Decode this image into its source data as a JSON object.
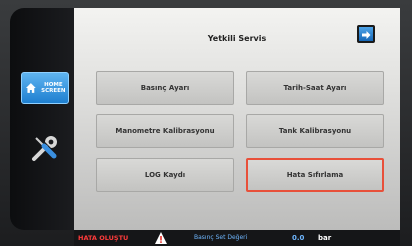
{
  "sidebar": {
    "home_label": "HOME\nSCREEN",
    "home_icon": "house-icon",
    "service_icon": "wrench-screwdriver-icon"
  },
  "screen": {
    "title": "Yetkili Servis",
    "next_icon": "arrow-right-icon",
    "buttons": [
      {
        "label": "Basınç Ayarı"
      },
      {
        "label": "Tarih-Saat Ayarı"
      },
      {
        "label": "Manometre Kalibrasyonu"
      },
      {
        "label": "Tank Kalibrasyonu"
      },
      {
        "label": "LOG Kaydı"
      },
      {
        "label": "Hata Sıfırlama"
      }
    ],
    "selected_button_color": "#e8503a"
  },
  "status": {
    "error_label": "HATA OLUŞTU",
    "warning_icon": "warning-triangle-icon",
    "setpoint_label": "Basınç Set Değeri",
    "setpoint_value": "0.0",
    "setpoint_unit": "bar"
  }
}
